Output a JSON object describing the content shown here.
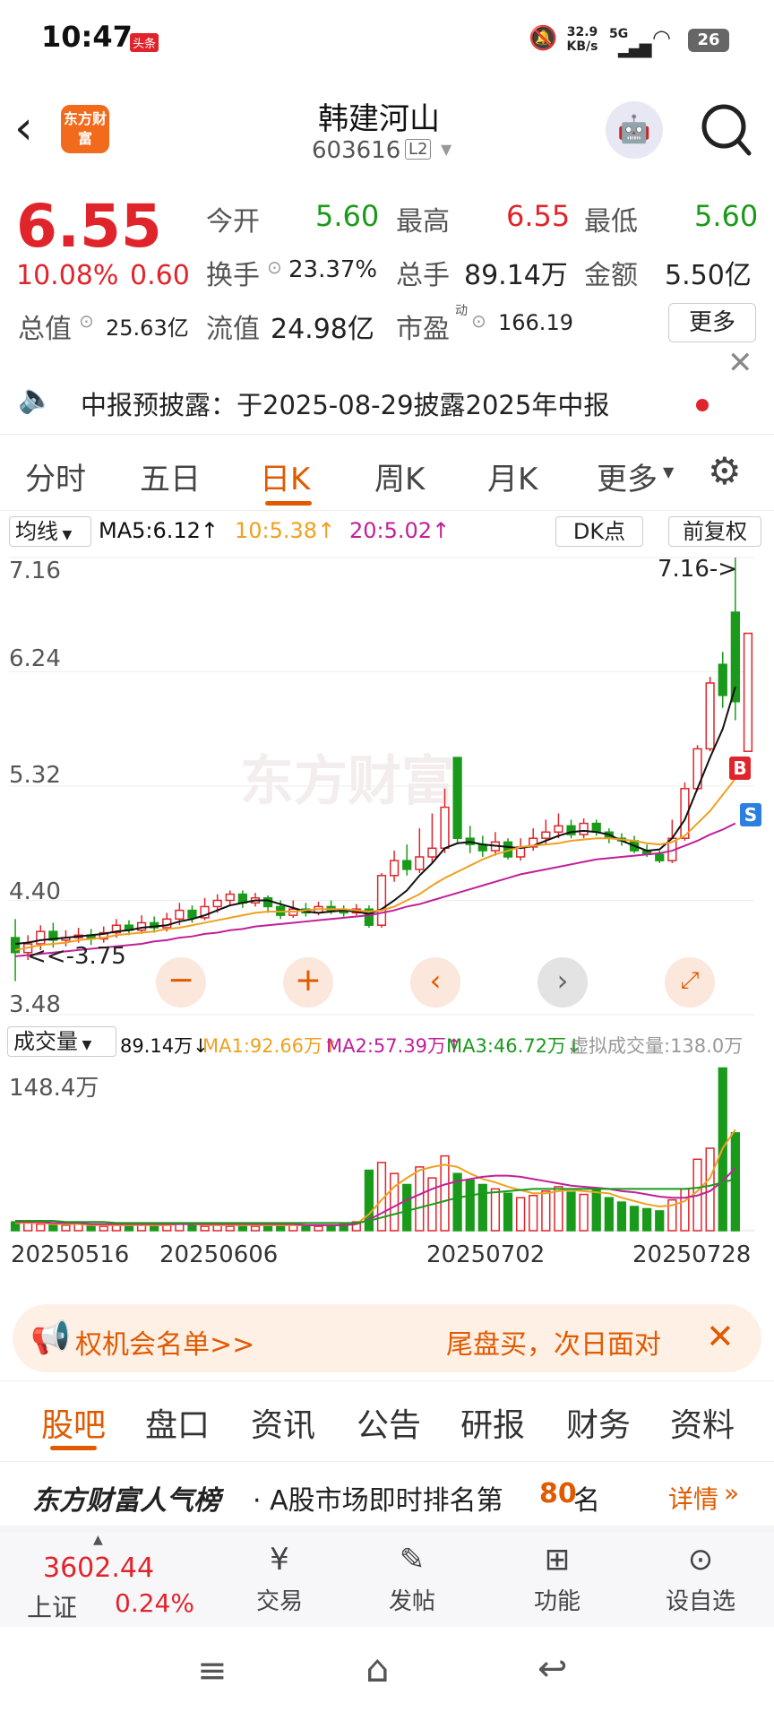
{
  "status": {
    "time": "10:47",
    "badge": "头条",
    "net_speed": "32.9",
    "net_unit": "KB/s",
    "signal": "5G",
    "battery": "26"
  },
  "header": {
    "brand": "东方财富",
    "title": "韩建河山",
    "code": "603616",
    "level": "L2"
  },
  "quote": {
    "price": "6.55",
    "change_pct": "10.08%",
    "change": "0.60",
    "open_label": "今开",
    "open": "5.60",
    "high_label": "最高",
    "high": "6.55",
    "low_label": "最低",
    "low": "5.60",
    "turnover_label": "换手",
    "turnover": "23.37%",
    "volume_label": "总手",
    "volume": "89.14万",
    "amount_label": "金额",
    "amount": "5.50亿",
    "mcap_label": "总值",
    "mcap": "25.63亿",
    "float_label": "流值",
    "float": "24.98亿",
    "pe_label": "市盈",
    "pe_sup": "动",
    "pe": "166.19",
    "more_label": "更多"
  },
  "notice": {
    "text": "中报预披露：于2025-08-29披露2025年中报"
  },
  "tabs": [
    "分时",
    "五日",
    "日K",
    "周K",
    "月K",
    "更多"
  ],
  "chart_header": {
    "ma_select": "均线",
    "ma5": "MA5:6.12↑",
    "ma10": "10:5.38↑",
    "ma20": "20:5.02↑",
    "dk": "DK点",
    "adjust": "前复权"
  },
  "chart": {
    "y_labels": [
      "7.16",
      "6.24",
      "5.32",
      "4.40",
      "3.48"
    ],
    "max_marker": "7.16->",
    "min_marker": "<<-3.75",
    "watermark": "东方财富",
    "b_mark": "B",
    "s_mark": "S"
  },
  "volume_header": {
    "select": "成交量",
    "vol": "89.14万↓",
    "ma1": "MA1:92.66万↑",
    "ma2": "MA2:57.39万↑",
    "ma3": "MA3:46.72万↓",
    "virtual": "虚拟成交量:138.0万"
  },
  "volume": {
    "max_label": "148.4万",
    "dates": [
      "20250516",
      "20250606",
      "20250702",
      "20250728"
    ]
  },
  "banner": {
    "left": "权机会名单>>",
    "right": "尾盘买，次日面对"
  },
  "subtabs": [
    "股吧",
    "盘口",
    "资讯",
    "公告",
    "研报",
    "财务",
    "资料"
  ],
  "rank": {
    "brand": "东方财富人气榜",
    "text": "· A股市场即时排名第",
    "rank": "80",
    "suffix": "名",
    "detail": "详情"
  },
  "bottom_nav": {
    "index_value": "3602.44",
    "index_name": "上证",
    "index_pct": "0.24%",
    "items": [
      "交易",
      "发帖",
      "功能",
      "设自选"
    ]
  },
  "colors": {
    "up": "#e0242b",
    "down": "#1a9a1a",
    "accent": "#e05a00",
    "ma5": "#111111",
    "ma10": "#f0a020",
    "ma20": "#c0209a"
  },
  "chart_data": {
    "type": "candlestick",
    "y_range": [
      3.48,
      7.16
    ],
    "candles": [
      {
        "o": 4.1,
        "c": 3.98,
        "h": 4.25,
        "l": 3.75
      },
      {
        "o": 3.98,
        "c": 4.05,
        "h": 4.12,
        "l": 3.92
      },
      {
        "o": 4.05,
        "c": 4.15,
        "h": 4.2,
        "l": 4.0
      },
      {
        "o": 4.15,
        "c": 4.08,
        "h": 4.22,
        "l": 4.02
      },
      {
        "o": 4.08,
        "c": 4.1,
        "h": 4.16,
        "l": 4.03
      },
      {
        "o": 4.1,
        "c": 4.12,
        "h": 4.18,
        "l": 4.06
      },
      {
        "o": 4.12,
        "c": 4.09,
        "h": 4.17,
        "l": 4.04
      },
      {
        "o": 4.09,
        "c": 4.14,
        "h": 4.19,
        "l": 4.06
      },
      {
        "o": 4.14,
        "c": 4.2,
        "h": 4.25,
        "l": 4.1
      },
      {
        "o": 4.2,
        "c": 4.16,
        "h": 4.24,
        "l": 4.12
      },
      {
        "o": 4.16,
        "c": 4.22,
        "h": 4.28,
        "l": 4.13
      },
      {
        "o": 4.22,
        "c": 4.18,
        "h": 4.27,
        "l": 4.14
      },
      {
        "o": 4.18,
        "c": 4.25,
        "h": 4.3,
        "l": 4.15
      },
      {
        "o": 4.25,
        "c": 4.32,
        "h": 4.38,
        "l": 4.2
      },
      {
        "o": 4.32,
        "c": 4.26,
        "h": 4.36,
        "l": 4.22
      },
      {
        "o": 4.26,
        "c": 4.35,
        "h": 4.42,
        "l": 4.24
      },
      {
        "o": 4.35,
        "c": 4.4,
        "h": 4.45,
        "l": 4.3
      },
      {
        "o": 4.4,
        "c": 4.45,
        "h": 4.48,
        "l": 4.36
      },
      {
        "o": 4.45,
        "c": 4.38,
        "h": 4.48,
        "l": 4.34
      },
      {
        "o": 4.38,
        "c": 4.42,
        "h": 4.46,
        "l": 4.35
      },
      {
        "o": 4.42,
        "c": 4.35,
        "h": 4.44,
        "l": 4.3
      },
      {
        "o": 4.35,
        "c": 4.28,
        "h": 4.4,
        "l": 4.25
      },
      {
        "o": 4.28,
        "c": 4.33,
        "h": 4.4,
        "l": 4.26
      },
      {
        "o": 4.33,
        "c": 4.3,
        "h": 4.38,
        "l": 4.27
      },
      {
        "o": 4.3,
        "c": 4.35,
        "h": 4.39,
        "l": 4.28
      },
      {
        "o": 4.35,
        "c": 4.32,
        "h": 4.4,
        "l": 4.29
      },
      {
        "o": 4.32,
        "c": 4.3,
        "h": 4.36,
        "l": 4.27
      },
      {
        "o": 4.3,
        "c": 4.33,
        "h": 4.37,
        "l": 4.28
      },
      {
        "o": 4.33,
        "c": 4.2,
        "h": 4.36,
        "l": 4.18
      },
      {
        "o": 4.2,
        "c": 4.6,
        "h": 4.62,
        "l": 4.18
      },
      {
        "o": 4.6,
        "c": 4.72,
        "h": 4.8,
        "l": 4.55
      },
      {
        "o": 4.72,
        "c": 4.65,
        "h": 4.85,
        "l": 4.6
      },
      {
        "o": 4.65,
        "c": 4.75,
        "h": 4.98,
        "l": 4.62
      },
      {
        "o": 4.75,
        "c": 4.82,
        "h": 5.1,
        "l": 4.7
      },
      {
        "o": 4.82,
        "c": 5.15,
        "h": 5.3,
        "l": 4.78
      },
      {
        "o": 5.55,
        "c": 4.9,
        "h": 5.55,
        "l": 4.85
      },
      {
        "o": 4.9,
        "c": 4.85,
        "h": 5.0,
        "l": 4.78
      },
      {
        "o": 4.85,
        "c": 4.8,
        "h": 4.92,
        "l": 4.75
      },
      {
        "o": 4.8,
        "c": 4.87,
        "h": 4.95,
        "l": 4.76
      },
      {
        "o": 4.87,
        "c": 4.75,
        "h": 4.9,
        "l": 4.73
      },
      {
        "o": 4.75,
        "c": 4.83,
        "h": 4.9,
        "l": 4.72
      },
      {
        "o": 4.83,
        "c": 4.9,
        "h": 4.98,
        "l": 4.8
      },
      {
        "o": 4.9,
        "c": 4.95,
        "h": 5.05,
        "l": 4.85
      },
      {
        "o": 4.95,
        "c": 5.0,
        "h": 5.1,
        "l": 4.9
      },
      {
        "o": 5.0,
        "c": 4.93,
        "h": 5.05,
        "l": 4.9
      },
      {
        "o": 4.93,
        "c": 5.02,
        "h": 5.06,
        "l": 4.9
      },
      {
        "o": 5.02,
        "c": 4.95,
        "h": 5.05,
        "l": 4.92
      },
      {
        "o": 4.95,
        "c": 4.9,
        "h": 4.98,
        "l": 4.86
      },
      {
        "o": 4.9,
        "c": 4.88,
        "h": 4.94,
        "l": 4.84
      },
      {
        "o": 4.88,
        "c": 4.8,
        "h": 4.92,
        "l": 4.78
      },
      {
        "o": 4.8,
        "c": 4.77,
        "h": 4.85,
        "l": 4.75
      },
      {
        "o": 4.77,
        "c": 4.72,
        "h": 4.8,
        "l": 4.7
      },
      {
        "o": 4.72,
        "c": 4.9,
        "h": 5.05,
        "l": 4.7
      },
      {
        "o": 4.9,
        "c": 5.3,
        "h": 5.35,
        "l": 4.88
      },
      {
        "o": 5.3,
        "c": 5.62,
        "h": 5.65,
        "l": 5.28
      },
      {
        "o": 5.62,
        "c": 6.15,
        "h": 6.2,
        "l": 5.6
      },
      {
        "o": 6.3,
        "c": 6.05,
        "h": 6.4,
        "l": 5.95
      },
      {
        "o": 6.72,
        "c": 6.0,
        "h": 7.16,
        "l": 5.85
      },
      {
        "o": 5.6,
        "c": 6.55,
        "h": 6.55,
        "l": 5.6
      }
    ],
    "ma5": [
      4.05,
      4.06,
      4.08,
      4.09,
      4.1,
      4.11,
      4.12,
      4.13,
      4.15,
      4.16,
      4.18,
      4.19,
      4.2,
      4.23,
      4.25,
      4.28,
      4.32,
      4.36,
      4.38,
      4.4,
      4.4,
      4.37,
      4.34,
      4.31,
      4.3,
      4.31,
      4.32,
      4.31,
      4.29,
      4.33,
      4.4,
      4.48,
      4.6,
      4.7,
      4.82,
      4.86,
      4.87,
      4.85,
      4.84,
      4.83,
      4.82,
      4.84,
      4.88,
      4.92,
      4.95,
      4.96,
      4.95,
      4.93,
      4.88,
      4.84,
      4.8,
      4.81,
      4.9,
      5.05,
      5.3,
      5.55,
      5.78,
      6.12
    ],
    "ma10": [
      4.0,
      4.02,
      4.04,
      4.05,
      4.06,
      4.08,
      4.09,
      4.1,
      4.12,
      4.13,
      4.14,
      4.15,
      4.17,
      4.18,
      4.2,
      4.22,
      4.24,
      4.26,
      4.28,
      4.3,
      4.31,
      4.31,
      4.31,
      4.32,
      4.33,
      4.33,
      4.33,
      4.32,
      4.31,
      4.32,
      4.35,
      4.4,
      4.45,
      4.52,
      4.58,
      4.63,
      4.68,
      4.73,
      4.77,
      4.8,
      4.83,
      4.84,
      4.85,
      4.86,
      4.88,
      4.89,
      4.9,
      4.9,
      4.89,
      4.88,
      4.86,
      4.85,
      4.87,
      4.92,
      5.02,
      5.12,
      5.25,
      5.38
    ],
    "ma20": [
      3.95,
      3.96,
      3.97,
      3.98,
      3.99,
      4.0,
      4.01,
      4.02,
      4.03,
      4.04,
      4.05,
      4.07,
      4.08,
      4.1,
      4.11,
      4.13,
      4.14,
      4.16,
      4.17,
      4.19,
      4.2,
      4.21,
      4.22,
      4.23,
      4.24,
      4.25,
      4.26,
      4.27,
      4.28,
      4.3,
      4.32,
      4.35,
      4.37,
      4.4,
      4.43,
      4.46,
      4.49,
      4.52,
      4.55,
      4.58,
      4.61,
      4.63,
      4.65,
      4.67,
      4.69,
      4.71,
      4.73,
      4.74,
      4.75,
      4.76,
      4.77,
      4.78,
      4.8,
      4.84,
      4.88,
      4.93,
      4.97,
      5.02
    ],
    "volumes": [
      8,
      7,
      6,
      7,
      5,
      6,
      5,
      4,
      5,
      6,
      5,
      4,
      6,
      7,
      5,
      4,
      5,
      4,
      5,
      4,
      6,
      5,
      5,
      4,
      4,
      5,
      6,
      8,
      55,
      62,
      52,
      42,
      58,
      48,
      68,
      52,
      46,
      42,
      38,
      34,
      30,
      32,
      36,
      40,
      35,
      33,
      38,
      30,
      26,
      22,
      20,
      18,
      28,
      38,
      65,
      75,
      148,
      89
    ],
    "vol_ma1": [
      7,
      7,
      7,
      6,
      6,
      6,
      5,
      5,
      5,
      5,
      5,
      5,
      5,
      6,
      6,
      5,
      5,
      5,
      5,
      5,
      5,
      5,
      5,
      5,
      5,
      5,
      5,
      6,
      15,
      28,
      40,
      48,
      55,
      58,
      60,
      58,
      52,
      47,
      44,
      40,
      37,
      34,
      34,
      36,
      37,
      36,
      35,
      34,
      30,
      27,
      24,
      22,
      23,
      27,
      36,
      48,
      75,
      92
    ],
    "vol_ma2": [
      8,
      8,
      8,
      7,
      7,
      7,
      6,
      6,
      6,
      6,
      6,
      6,
      6,
      6,
      6,
      6,
      6,
      6,
      6,
      6,
      6,
      6,
      6,
      5,
      5,
      5,
      5,
      6,
      10,
      16,
      22,
      28,
      33,
      38,
      42,
      45,
      47,
      49,
      50,
      50,
      49,
      47,
      45,
      43,
      41,
      40,
      39,
      38,
      36,
      35,
      33,
      31,
      30,
      30,
      32,
      36,
      45,
      57
    ],
    "vol_ma3": [
      9,
      9,
      9,
      9,
      8,
      8,
      8,
      8,
      7,
      7,
      7,
      7,
      7,
      7,
      7,
      7,
      7,
      7,
      7,
      7,
      7,
      7,
      7,
      7,
      7,
      7,
      7,
      7,
      9,
      12,
      15,
      18,
      21,
      24,
      27,
      30,
      32,
      34,
      35,
      36,
      37,
      38,
      38,
      38,
      38,
      38,
      38,
      38,
      38,
      38,
      38,
      38,
      38,
      38,
      39,
      41,
      44,
      47
    ]
  }
}
